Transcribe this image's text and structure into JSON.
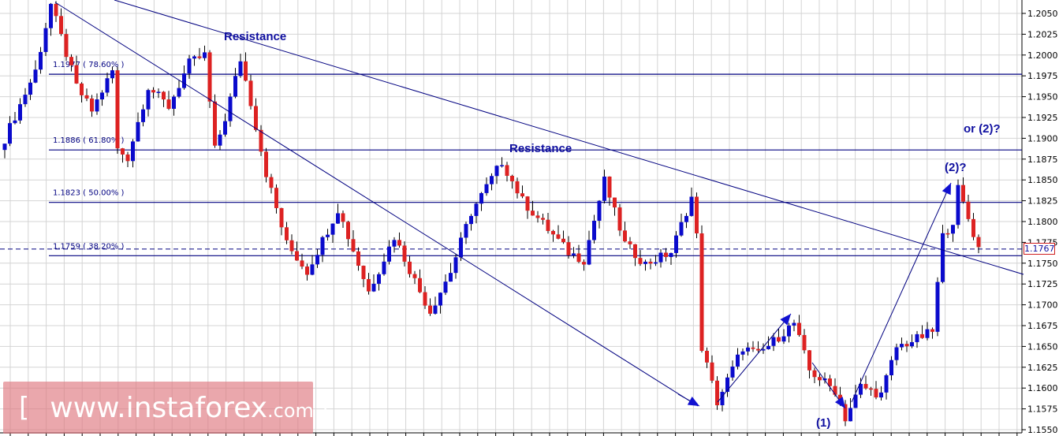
{
  "chart_data": {
    "type": "candlestick",
    "title": "",
    "instrument_note": "",
    "ylim": [
      1.1545,
      1.2065
    ],
    "y_ticks": [
      "1.2050",
      "1.2025",
      "1.2000",
      "1.1975",
      "1.1950",
      "1.1925",
      "1.1900",
      "1.1875",
      "1.1850",
      "1.1825",
      "1.1800",
      "1.1775",
      "1.1750",
      "1.1725",
      "1.1700",
      "1.1675",
      "1.1650",
      "1.1625",
      "1.1600",
      "1.1575",
      "1.1550"
    ],
    "current_price": "1.1767",
    "candle_count": 191,
    "price_path": [
      [
        0,
        1.1886
      ],
      [
        7,
        1.1981
      ],
      [
        10,
        1.2061
      ],
      [
        15,
        1.1962
      ],
      [
        18,
        1.1933
      ],
      [
        22,
        1.1981
      ],
      [
        23,
        1.1886
      ],
      [
        25,
        1.1877
      ],
      [
        29,
        1.1962
      ],
      [
        33,
        1.1938
      ],
      [
        37,
        1.199
      ],
      [
        40,
        1.2
      ],
      [
        42,
        1.1886
      ],
      [
        44,
        1.1924
      ],
      [
        47,
        1.1995
      ],
      [
        49,
        1.1943
      ],
      [
        52,
        1.1858
      ],
      [
        56,
        1.1773
      ],
      [
        60,
        1.174
      ],
      [
        66,
        1.1815
      ],
      [
        72,
        1.1716
      ],
      [
        77,
        1.1782
      ],
      [
        82,
        1.1716
      ],
      [
        84,
        1.1692
      ],
      [
        88,
        1.174
      ],
      [
        92,
        1.1811
      ],
      [
        98,
        1.1872
      ],
      [
        102,
        1.1825
      ],
      [
        111,
        1.1763
      ],
      [
        114,
        1.1754
      ],
      [
        118,
        1.1849
      ],
      [
        122,
        1.1773
      ],
      [
        126,
        1.1749
      ],
      [
        131,
        1.1763
      ],
      [
        135,
        1.1829
      ],
      [
        136,
        1.1782
      ],
      [
        137,
        1.1649
      ],
      [
        140,
        1.1583
      ],
      [
        145,
        1.1649
      ],
      [
        148,
        1.164
      ],
      [
        155,
        1.1678
      ],
      [
        158,
        1.1621
      ],
      [
        163,
        1.1597
      ],
      [
        165,
        1.1564
      ],
      [
        168,
        1.1602
      ],
      [
        172,
        1.1592
      ],
      [
        175,
        1.1649
      ],
      [
        179,
        1.1659
      ],
      [
        182,
        1.1668
      ],
      [
        184,
        1.1782
      ],
      [
        186,
        1.1801
      ],
      [
        187,
        1.1839
      ],
      [
        191,
        1.1768
      ]
    ],
    "fib_levels": [
      {
        "price": 1.1977,
        "label": "1.1977 ( 78.60% )"
      },
      {
        "price": 1.1886,
        "label": "1.1886 ( 61.80% )"
      },
      {
        "price": 1.1823,
        "label": "1.1823 ( 50.00% )"
      },
      {
        "price": 1.1759,
        "label": "1.1759 ( 38.20% )"
      }
    ],
    "trendlines": [
      {
        "from": [
          22,
          2.207
        ],
        "to": [
          199,
          1.1734
        ]
      },
      {
        "from": [
          11,
          1.206
        ],
        "to": [
          136,
          1.158
        ]
      }
    ],
    "arrows": [
      {
        "from": [
          140,
          1.1583
        ],
        "to": [
          154,
          1.169
        ]
      },
      {
        "from": [
          158,
          1.163
        ],
        "to": [
          165,
          1.1568
        ]
      },
      {
        "from": [
          166,
          1.1578
        ],
        "to": [
          186,
          1.1845
        ]
      }
    ],
    "annotations": [
      {
        "text": "Resistance",
        "candle": 44,
        "price": 1.2033
      },
      {
        "text": "Resistance",
        "candle": 99,
        "price": 1.1898
      },
      {
        "text": "(2)?",
        "candle": 184,
        "price": 1.1865
      },
      {
        "text": "or (2)?",
        "candle": 188,
        "price": 1.1912
      },
      {
        "text": "(1)",
        "candle": 159,
        "price": 1.1553
      }
    ],
    "colors": {
      "bull": "#0a0acc",
      "bear": "#dd2222",
      "line": "#000080",
      "grid": "#d4d4d4"
    }
  },
  "watermark": {
    "open": "[",
    "site": "www.instaforex",
    "tld": ".com",
    "close": "]"
  }
}
